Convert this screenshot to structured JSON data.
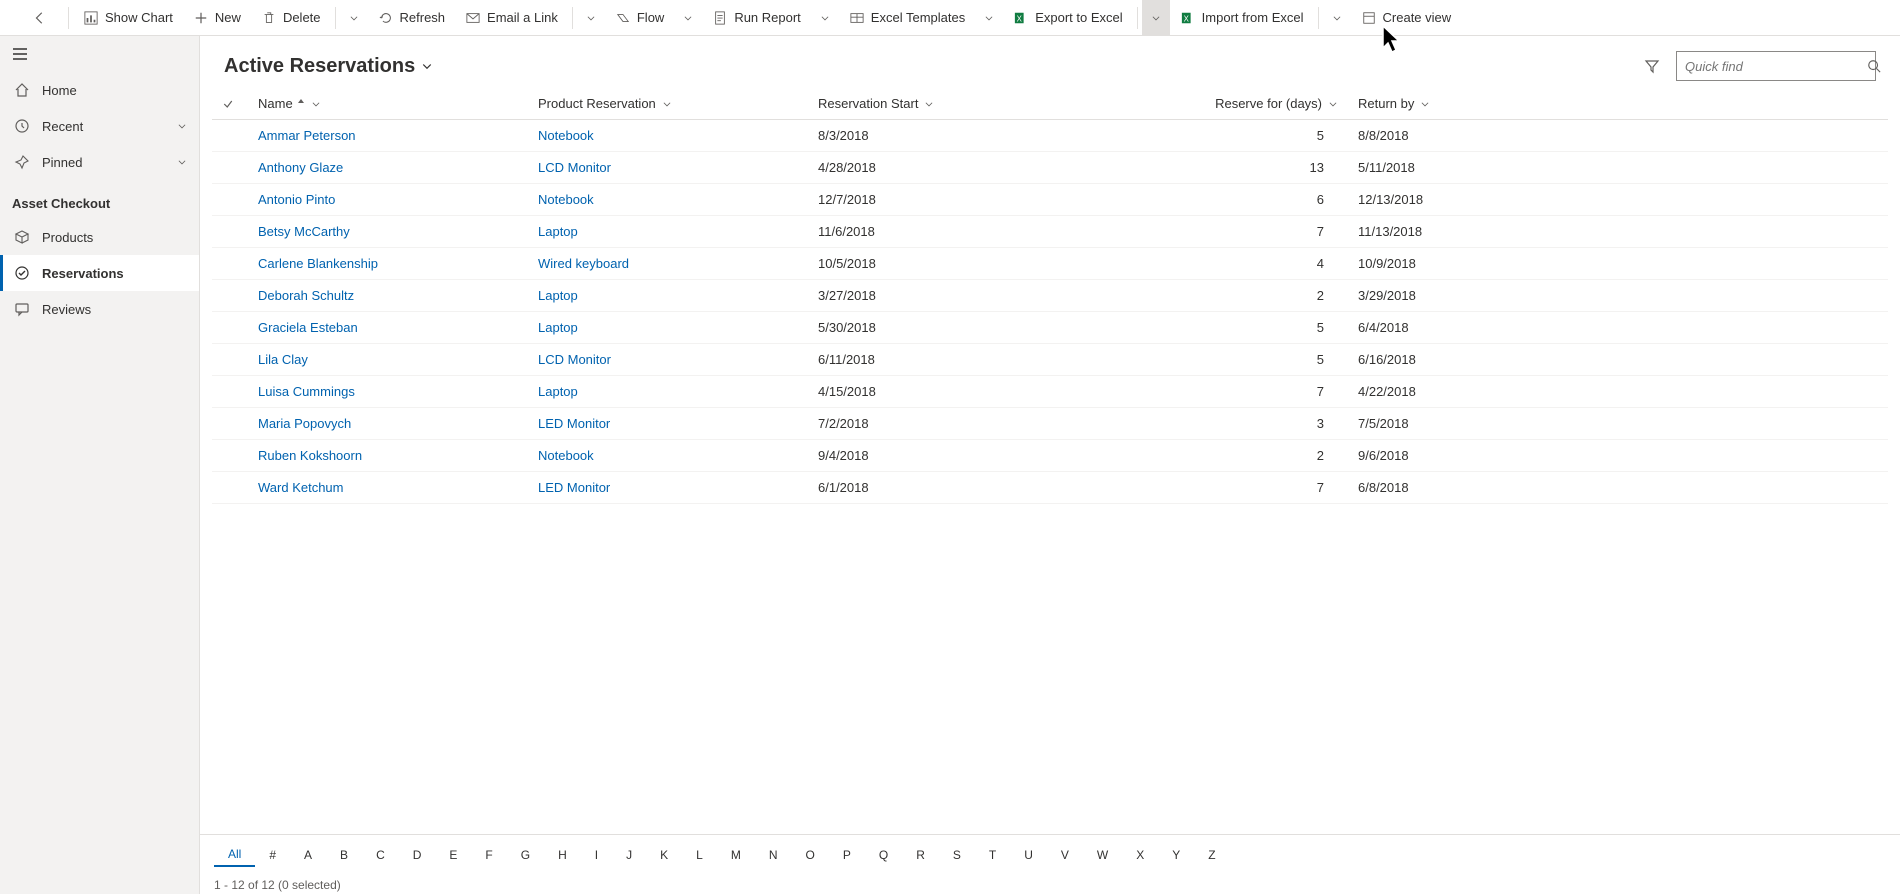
{
  "commandbar": {
    "show_chart": "Show Chart",
    "new": "New",
    "delete": "Delete",
    "refresh": "Refresh",
    "email_link": "Email a Link",
    "flow": "Flow",
    "run_report": "Run Report",
    "excel_templates": "Excel Templates",
    "export_excel": "Export to Excel",
    "import_excel": "Import from Excel",
    "create_view": "Create view"
  },
  "sidebar": {
    "home": "Home",
    "recent": "Recent",
    "pinned": "Pinned",
    "section_label": "Asset Checkout",
    "products": "Products",
    "reservations": "Reservations",
    "reviews": "Reviews"
  },
  "view": {
    "title": "Active Reservations",
    "search_placeholder": "Quick find"
  },
  "columns": {
    "name": "Name",
    "product": "Product Reservation",
    "start": "Reservation Start",
    "days": "Reserve for (days)",
    "return": "Return by"
  },
  "rows": [
    {
      "name": "Ammar Peterson",
      "product": "Notebook",
      "start": "8/3/2018",
      "days": "5",
      "return": "8/8/2018"
    },
    {
      "name": "Anthony Glaze",
      "product": "LCD Monitor",
      "start": "4/28/2018",
      "days": "13",
      "return": "5/11/2018"
    },
    {
      "name": "Antonio Pinto",
      "product": "Notebook",
      "start": "12/7/2018",
      "days": "6",
      "return": "12/13/2018"
    },
    {
      "name": "Betsy McCarthy",
      "product": "Laptop",
      "start": "11/6/2018",
      "days": "7",
      "return": "11/13/2018"
    },
    {
      "name": "Carlene Blankenship",
      "product": "Wired keyboard",
      "start": "10/5/2018",
      "days": "4",
      "return": "10/9/2018"
    },
    {
      "name": "Deborah Schultz",
      "product": "Laptop",
      "start": "3/27/2018",
      "days": "2",
      "return": "3/29/2018"
    },
    {
      "name": "Graciela Esteban",
      "product": "Laptop",
      "start": "5/30/2018",
      "days": "5",
      "return": "6/4/2018"
    },
    {
      "name": "Lila Clay",
      "product": "LCD Monitor",
      "start": "6/11/2018",
      "days": "5",
      "return": "6/16/2018"
    },
    {
      "name": "Luisa Cummings",
      "product": "Laptop",
      "start": "4/15/2018",
      "days": "7",
      "return": "4/22/2018"
    },
    {
      "name": "Maria Popovych",
      "product": "LED Monitor",
      "start": "7/2/2018",
      "days": "3",
      "return": "7/5/2018"
    },
    {
      "name": "Ruben Kokshoorn",
      "product": "Notebook",
      "start": "9/4/2018",
      "days": "2",
      "return": "9/6/2018"
    },
    {
      "name": "Ward Ketchum",
      "product": "LED Monitor",
      "start": "6/1/2018",
      "days": "7",
      "return": "6/8/2018"
    }
  ],
  "alpha": [
    "All",
    "#",
    "A",
    "B",
    "C",
    "D",
    "E",
    "F",
    "G",
    "H",
    "I",
    "J",
    "K",
    "L",
    "M",
    "N",
    "O",
    "P",
    "Q",
    "R",
    "S",
    "T",
    "U",
    "V",
    "W",
    "X",
    "Y",
    "Z"
  ],
  "status": "1 - 12 of 12 (0 selected)"
}
